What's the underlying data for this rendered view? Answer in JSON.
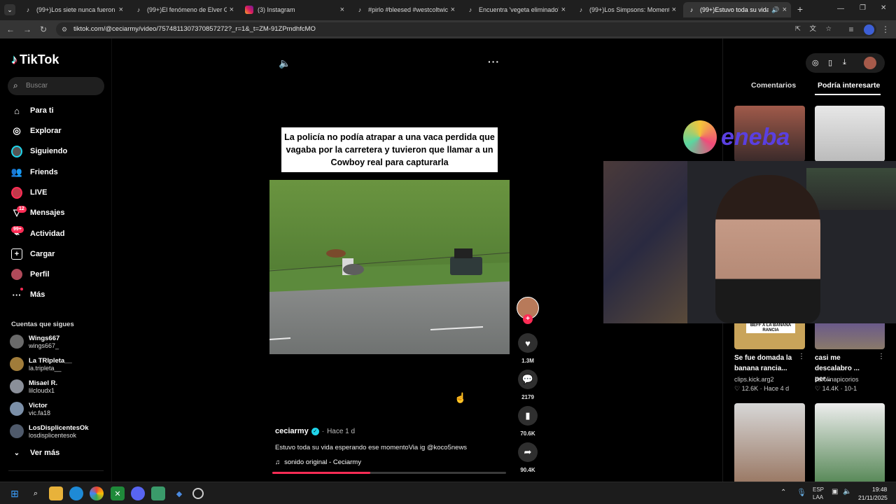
{
  "browser": {
    "tabs": [
      {
        "title": "(99+)Los siete nunca fueron cr..."
      },
      {
        "title": "(99+)El fenómeno de Elver Gala..."
      },
      {
        "title": "(3) Instagram"
      },
      {
        "title": "#pirlo #bleesed #westcoltwich..."
      },
      {
        "title": "Encuentra 'vegeta eliminado' e..."
      },
      {
        "title": "(99+)Los Simpsons: Momentos..."
      },
      {
        "title": "(99+)Estuvo toda su vida e..."
      }
    ],
    "url": "tiktok.com/@ceciarmy/video/7574811307370857272?_r=1&_t=ZM-91ZPmdhfcMO",
    "new_tab": "+",
    "window_controls": [
      "—",
      "❐",
      "✕"
    ]
  },
  "sidebar": {
    "logo": "TikTok",
    "search_placeholder": "Buscar",
    "nav": [
      {
        "label": "Para ti",
        "icon": "home-icon"
      },
      {
        "label": "Explorar",
        "icon": "compass-icon"
      },
      {
        "label": "Siguiendo",
        "icon": "following-icon"
      },
      {
        "label": "Friends",
        "icon": "friends-icon"
      },
      {
        "label": "LIVE",
        "icon": "live-icon"
      },
      {
        "label": "Mensajes",
        "icon": "messages-icon",
        "badge": "12"
      },
      {
        "label": "Actividad",
        "icon": "activity-icon",
        "badge": "99+"
      },
      {
        "label": "Cargar",
        "icon": "upload-icon"
      },
      {
        "label": "Perfil",
        "icon": "profile-icon"
      },
      {
        "label": "Más",
        "icon": "more-icon"
      }
    ],
    "following_header": "Cuentas que sigues",
    "following": [
      {
        "name": "Wings667",
        "handle": "wings667_",
        "color": "#6a6a6a"
      },
      {
        "name": "La TRIpleta__",
        "handle": "la.tripleta__",
        "color": "#a07c3a"
      },
      {
        "name": "Misael R.",
        "handle": "lilcloudx1",
        "color": "#8a8f99"
      },
      {
        "name": "Victor",
        "handle": "vic.fa18",
        "color": "#7b8fa8"
      },
      {
        "name": "LosDisplicentesOk",
        "handle": "losdisplicentesok",
        "color": "#4f5a6b"
      }
    ],
    "see_more": "Ver más"
  },
  "video": {
    "caption_overlay": "La policía no podía atrapar a una vaca perdida que vagaba por la carretera y tuvieron que llamar a un Cowboy real para capturarla",
    "author": "ceciarmy",
    "time": "Hace 1 d",
    "description": "Estuvo toda su vida esperando ese momentoVia ig @koco5news",
    "sound": "sonido original - Ceciarmy",
    "progress": 0.42,
    "likes": "1.3M",
    "comments": "2179",
    "saves": "70.6K",
    "shares": "90.4K"
  },
  "right_panel": {
    "tabs": [
      "Comentarios",
      "Podría interesarte"
    ],
    "active_tab": 1,
    "brand_overlay": "eneba",
    "cards": [
      {
        "title": "Se fue domada la banana rancia...",
        "author": "clips.kick.arg2",
        "likes": "12.6K",
        "date": "Hace 4 d",
        "thumb_text": "BEFF A LA BANANA RANCIA"
      },
      {
        "title": "casi me descalabro ... per...",
        "author": "carolinapicorios",
        "likes": "14.4K",
        "date": "10-1"
      }
    ]
  },
  "taskbar": {
    "lang": "ESP",
    "lang2": "LAA",
    "time": "19:48",
    "date": "21/11/2025"
  },
  "colors": {
    "accent": "#fe2c55",
    "verified": "#20d5ec"
  }
}
